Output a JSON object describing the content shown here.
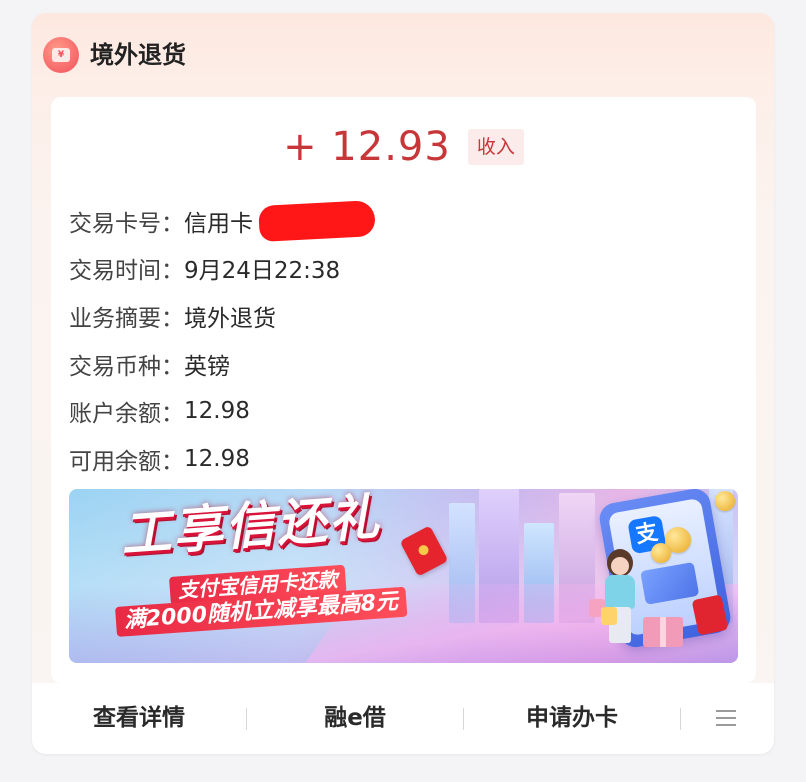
{
  "header": {
    "title": "境外退货",
    "icon": "yen-card-icon",
    "icon_glyph": "¥"
  },
  "transaction": {
    "amount": "+ 12.93",
    "amount_tag": "收入",
    "rows": [
      {
        "label": "交易卡号：",
        "value": "信用卡"
      },
      {
        "label": "交易时间：",
        "value": "9月24日22:38"
      },
      {
        "label": "业务摘要：",
        "value": "境外退货"
      },
      {
        "label": "交易币种：",
        "value": "英镑"
      },
      {
        "label": "账户余额：",
        "value": "12.98"
      },
      {
        "label": "可用余额：",
        "value": "12.98"
      }
    ]
  },
  "banner": {
    "headline": "工享信还礼",
    "line1": "支付宝信用卡还款",
    "line2": "满2000随机立减享最高8元",
    "app_icon_glyph": "支"
  },
  "footer": {
    "buttons": [
      "查看详情",
      "融e借",
      "申请办卡"
    ],
    "more_icon": "hamburger-menu-icon"
  },
  "colors": {
    "accent_red": "#c7373a",
    "tag_bg": "#fbeceb",
    "redaction": "#ff1616"
  }
}
